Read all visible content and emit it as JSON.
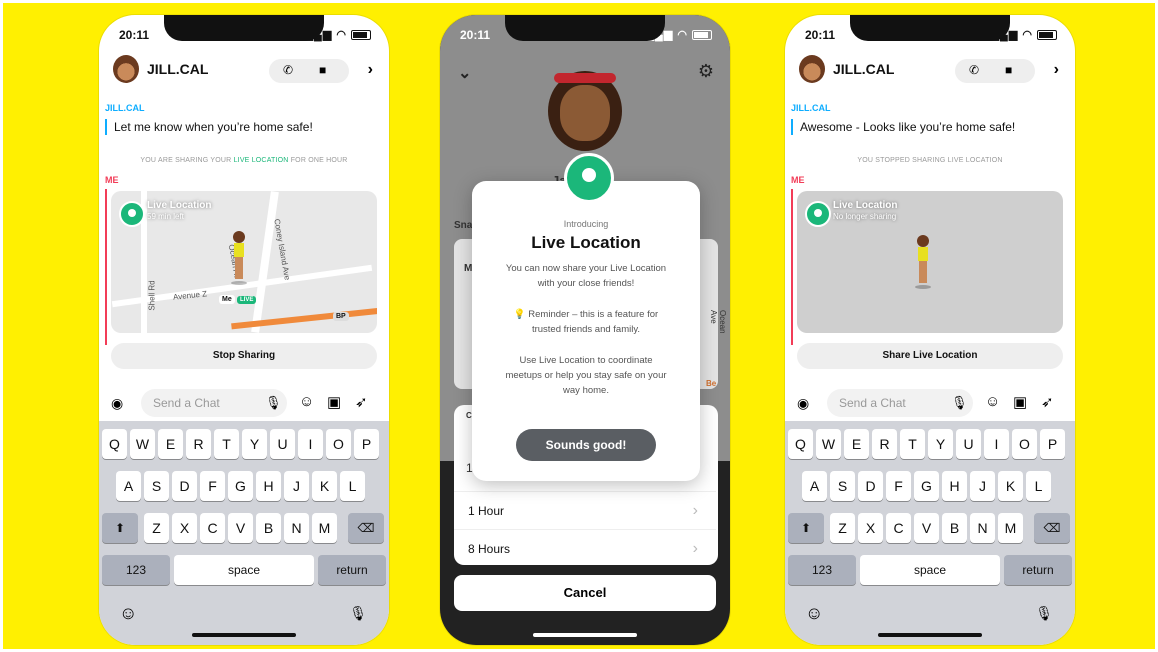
{
  "status": {
    "time": "20:11",
    "signal": "..ıl",
    "wifi": "≋"
  },
  "left_phone": {
    "contact": "JILL.CAL",
    "sender": "JILL.CAL",
    "message": "Let me know when you’re home safe!",
    "system_note_pre": "YOU ARE SHARING YOUR ",
    "system_note_hl": "LIVE LOCATION",
    "system_note_post": " FOR ONE HOUR",
    "me_label": "ME",
    "card_title": "Live Location",
    "card_sub": "59 min left",
    "streets": [
      "Shell Rd",
      "Ocean Av",
      "Coney Island Ave",
      "Avenue Z"
    ],
    "me_tag": "Me",
    "live_tag": "LIVE",
    "bp_tag": "BP",
    "button": "Stop Sharing",
    "chat_placeholder": "Send a Chat"
  },
  "middle_phone": {
    "peek_name": "Ja        dy",
    "peek_left": "Sna",
    "peek_m": "M",
    "peek_right": "Ocean Ave",
    "peek_c": "C",
    "peek_one": "1",
    "peek_be": "Be",
    "modal": {
      "intro": "Introducing",
      "title": "Live Location",
      "body1_line1": "You can now share your Live Location",
      "body1_line2": "with your close friends!",
      "body2_line1": "💡 Reminder – this is a feature for",
      "body2_line2": "trusted friends and family.",
      "body3_line1": "Use Live Location to coordinate",
      "body3_line2": "meetups or help you stay safe on your",
      "body3_line3": "way home.",
      "button": "Sounds good!"
    },
    "durations": [
      "1 Hour",
      "8 Hours"
    ],
    "cancel": "Cancel"
  },
  "right_phone": {
    "contact": "JILL.CAL",
    "sender": "JILL.CAL",
    "message": "Awesome - Looks like you’re home safe!",
    "system_note": "YOU STOPPED SHARING LIVE LOCATION",
    "me_label": "ME",
    "card_title": "Live Location",
    "card_sub": "No longer sharing",
    "button": "Share Live Location",
    "chat_placeholder": "Send a Chat"
  },
  "keyboard": {
    "row1": [
      "Q",
      "W",
      "E",
      "R",
      "T",
      "Y",
      "U",
      "I",
      "O",
      "P"
    ],
    "row2": [
      "A",
      "S",
      "D",
      "F",
      "G",
      "H",
      "J",
      "K",
      "L"
    ],
    "row3": [
      "Z",
      "X",
      "C",
      "V",
      "B",
      "N",
      "M"
    ],
    "numbers": "123",
    "space": "space",
    "return": "return"
  },
  "colors": {
    "background": "#FFF001",
    "accent_green": "#1bb77a",
    "sender_blue": "#0eadff",
    "me_red": "#f23c57"
  }
}
